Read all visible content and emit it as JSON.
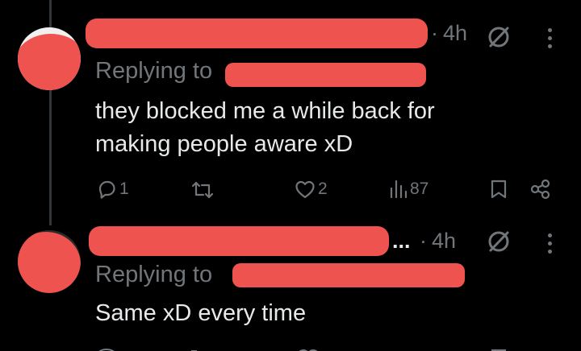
{
  "tweets": [
    {
      "time": "4h",
      "replying_label": "Replying to",
      "text_lines": [
        "they blocked me a while back for",
        "making people aware xD"
      ],
      "actions": {
        "reply_count": "1",
        "retweet_count": "",
        "like_count": "2",
        "views_count": "87"
      }
    },
    {
      "name_suffix": "...",
      "time": "4h",
      "replying_label": "Replying to",
      "text_lines": [
        "Same xD every time"
      ]
    }
  ],
  "icons": [
    "reply-icon",
    "retweet-icon",
    "like-icon",
    "views-icon",
    "bookmark-icon",
    "share-icon",
    "mute-icon",
    "more-icon"
  ],
  "colors": {
    "background": "#000000",
    "text": "#e7e9ea",
    "secondary": "#71767b",
    "redaction": "#ef5350"
  }
}
